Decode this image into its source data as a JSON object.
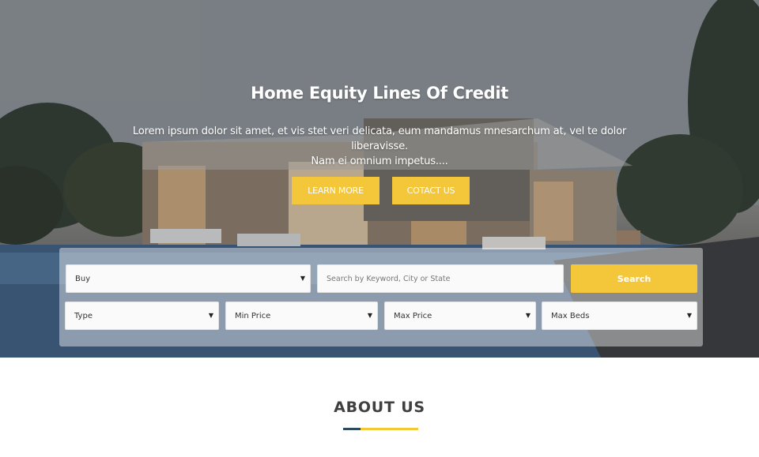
{
  "hero": {
    "title": "Home Equity Lines Of Credit",
    "subtitle_line1": "Lorem ipsum dolor sit amet, et vis stet veri delicata, eum mandamus mnesarchum at, vel te dolor liberavisse.",
    "subtitle_line2": "Nam ei omnium impetus....",
    "learn_more_label": "LEARN MORE",
    "contact_label": "COTACT US"
  },
  "search": {
    "status_select": "Buy",
    "keyword_placeholder": "Search by Keyword, City or State",
    "search_button": "Search",
    "type_select": "Type",
    "min_price_select": "Min Price",
    "max_price_select": "Max Price",
    "max_beds_select": "Max Beds"
  },
  "about": {
    "title": "ABOUT US"
  },
  "colors": {
    "accent": "#f4c63a",
    "navy": "#2d4a63"
  }
}
